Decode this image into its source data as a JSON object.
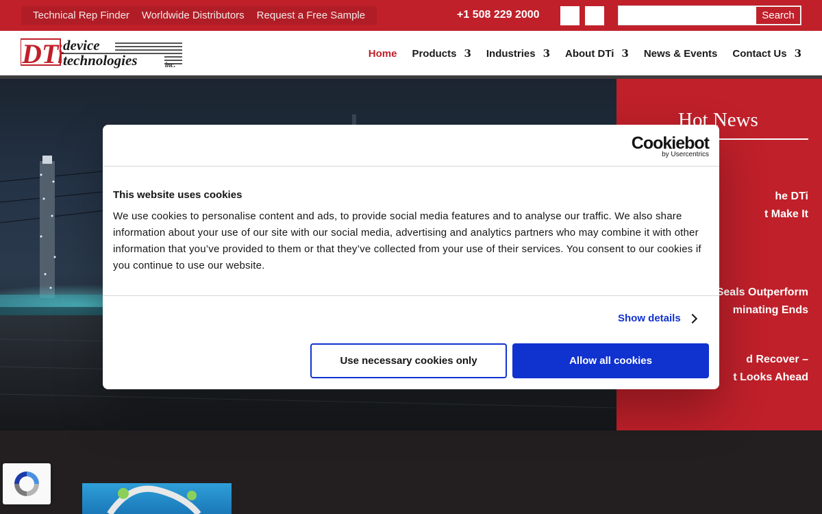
{
  "topbar": {
    "links": [
      "Technical Rep Finder",
      "Worldwide Distributors",
      "Request a Free Sample"
    ],
    "phone": "+1 508 229 2000",
    "search_label": "Search",
    "search_placeholder": ""
  },
  "brand": {
    "line1": "device",
    "line2": "technologies",
    "suffix": "inc.",
    "mark": "DTi"
  },
  "nav": {
    "items": [
      {
        "label": "Home",
        "active": true,
        "has_submenu": false
      },
      {
        "label": "Products",
        "has_submenu": true
      },
      {
        "label": "Industries",
        "has_submenu": true
      },
      {
        "label": "About DTi",
        "has_submenu": true
      },
      {
        "label": "News & Events",
        "has_submenu": false
      },
      {
        "label": "Contact Us",
        "has_submenu": true
      }
    ],
    "submenu_glyph": "3"
  },
  "hotnews": {
    "title": "Hot News",
    "items": [
      {
        "lines": [
          "he DTi",
          "t Make It"
        ]
      },
      {
        "lines": [
          "Seals Outperform",
          "minating Ends"
        ]
      },
      {
        "lines": [
          "d Recover –",
          "t Looks Ahead"
        ]
      }
    ]
  },
  "cookie": {
    "logo_main": "Cookiebot",
    "logo_sub": "by Usercentrics",
    "title": "This website uses cookies",
    "body": "We use cookies to personalise content and ads, to provide social media features and to analyse our traffic. We also share information about your use of our site with our social media, advertising and analytics partners who may combine it with other information that you’ve provided to them or that they’ve collected from your use of their services. You consent to our cookies if you continue to use our website.",
    "show_details": "Show details",
    "btn_necessary": "Use necessary cookies only",
    "btn_allow": "Allow all cookies"
  },
  "colors": {
    "brand_red": "#c0202a",
    "cookie_blue": "#1032cf"
  }
}
